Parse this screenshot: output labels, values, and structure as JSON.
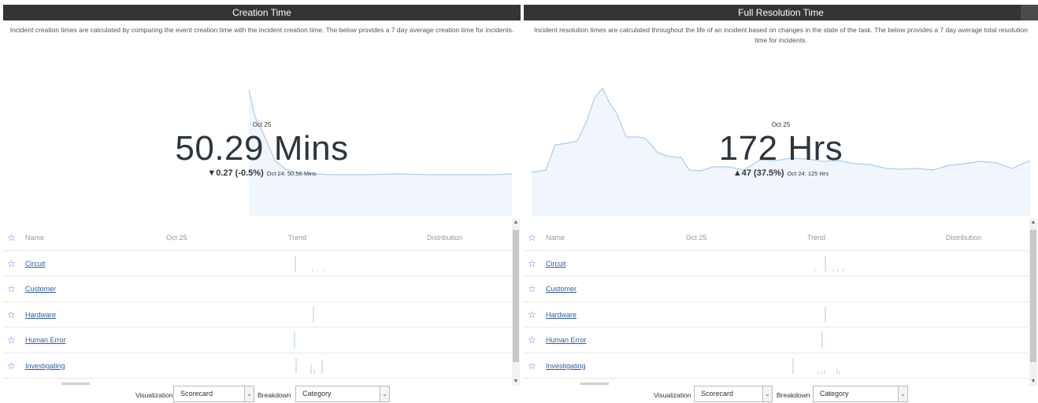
{
  "panels": [
    {
      "title": "Creation Time",
      "description": "Incident creation times are calculated by comparing the event creation time with the incident creation time.  The below provides a 7 day average creation time for incidents.",
      "score_date": "Oct 25",
      "score_value": "50.29 Mins",
      "change_arrow": "▼",
      "change_text": "0.27 (-0.5%)",
      "previous_text": "Oct 24: 50.56 Mins",
      "table": {
        "headers": {
          "name": "Name",
          "date": "Oct 25",
          "trend": "Trend",
          "distribution": "Distribution"
        },
        "rows": [
          "Circuit",
          "Customer",
          "Hardware",
          "Human Error",
          "Investigating"
        ]
      },
      "controls": {
        "visualization_label": "Visualization",
        "visualization_value": "Scorecard",
        "breakdown_label": "Breakdown",
        "breakdown_value": "Category"
      }
    },
    {
      "title": "Full Resolution Time",
      "description": "Incident resolution times are calculated throughout the life of an incident based on changes in the state of the task.  The below provides a 7 day average total resolution time for incidents.",
      "score_date": "Oct 25",
      "score_value": "172 Hrs",
      "change_arrow": "▲",
      "change_text": "47 (37.5%)",
      "previous_text": "Oct 24: 125 Hrs",
      "table": {
        "headers": {
          "name": "Name",
          "date": "Oct 25",
          "trend": "Trend",
          "distribution": "Distribution"
        },
        "rows": [
          "Circuit",
          "Customer",
          "Hardware",
          "Human Error",
          "Investigating"
        ]
      },
      "controls": {
        "visualization_label": "Visualization",
        "visualization_value": "Scorecard",
        "breakdown_label": "Breakdown",
        "breakdown_value": "Category"
      }
    }
  ],
  "icons": {
    "star": "star-icon",
    "dropdown": "chevron-down-icon"
  },
  "colors": {
    "header_bg": "#343434",
    "accent": "#4a7fd9",
    "spark_line": "#a9cdf0",
    "spark_fill": "#f1f6fc",
    "link": "#2b5ea6"
  }
}
